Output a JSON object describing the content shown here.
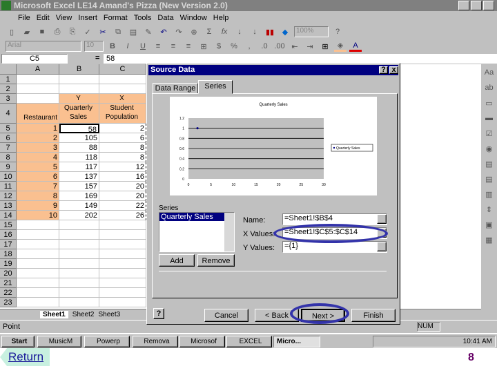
{
  "window": {
    "title": "Microsoft Excel   LE14 Amand's Pizza (New Version 2.0)"
  },
  "menu": [
    "File",
    "Edit",
    "View",
    "Insert",
    "Format",
    "Tools",
    "Data",
    "Window",
    "Help"
  ],
  "toolbar": {
    "zoom": "100%",
    "font": "Arial",
    "size": "10"
  },
  "formula": {
    "cell_ref": "C5",
    "equals": "=",
    "value": "58"
  },
  "sheet": {
    "columns": [
      "A",
      "B",
      "C"
    ],
    "row_numbers": [
      "1",
      "2",
      "3",
      "4",
      "5",
      "6",
      "7",
      "8",
      "9",
      "10",
      "11",
      "12",
      "13",
      "14",
      "15",
      "16",
      "17",
      "18",
      "19",
      "20",
      "21",
      "22",
      "23"
    ],
    "header_row3": [
      "",
      "Y",
      "X"
    ],
    "header_row4": [
      "Restaurant",
      "Quarterly Sales",
      "Student Population"
    ],
    "rows": [
      [
        "1",
        "58",
        "2"
      ],
      [
        "2",
        "105",
        "6"
      ],
      [
        "3",
        "88",
        "8"
      ],
      [
        "4",
        "118",
        "8"
      ],
      [
        "5",
        "117",
        "12"
      ],
      [
        "6",
        "137",
        "16"
      ],
      [
        "7",
        "157",
        "20"
      ],
      [
        "8",
        "169",
        "20"
      ],
      [
        "9",
        "149",
        "22"
      ],
      [
        "10",
        "202",
        "26"
      ]
    ],
    "tabs": [
      "Sheet1",
      "Sheet2",
      "Sheet3"
    ]
  },
  "dialog": {
    "title": "Source Data",
    "help": "?",
    "close": "x",
    "tabs": [
      "Data Range",
      "Series"
    ],
    "series_label": "Series",
    "series_items": [
      "Quarterly Sales"
    ],
    "add": "Add",
    "remove": "Remove",
    "name_label": "Name:",
    "name_value": "=Sheet1!$B$4",
    "x_label": "X Values:",
    "x_value": "=Sheet1!$C$5:$C$14",
    "y_label": "Y Values:",
    "y_value": "={1}",
    "cancel": "Cancel",
    "back": "< Back",
    "next": "Next >",
    "finish": "Finish"
  },
  "chart_data": {
    "type": "scatter",
    "title": "Quarterly Sales",
    "series": [
      {
        "name": "Quarterly Sales",
        "x": [
          2
        ],
        "y": [
          1
        ]
      }
    ],
    "xlim": [
      0,
      30
    ],
    "ylim": [
      0,
      1.2
    ],
    "xticks": [
      "0",
      "5",
      "10",
      "15",
      "20",
      "25",
      "30"
    ],
    "yticks": [
      "0",
      "0.2",
      "0.4",
      "0.6",
      "0.8",
      "1",
      "1.2"
    ],
    "legend": "right",
    "grid": true
  },
  "status": {
    "mode": "Point",
    "num": "NUM"
  },
  "taskbar": {
    "start": "Start",
    "items": [
      "MusicM",
      "Powerp",
      "Remova",
      "Microsof",
      "EXCEL",
      "Micro..."
    ],
    "clock": "10:41 AM"
  },
  "slide": {
    "return": "Return",
    "page": "8"
  }
}
